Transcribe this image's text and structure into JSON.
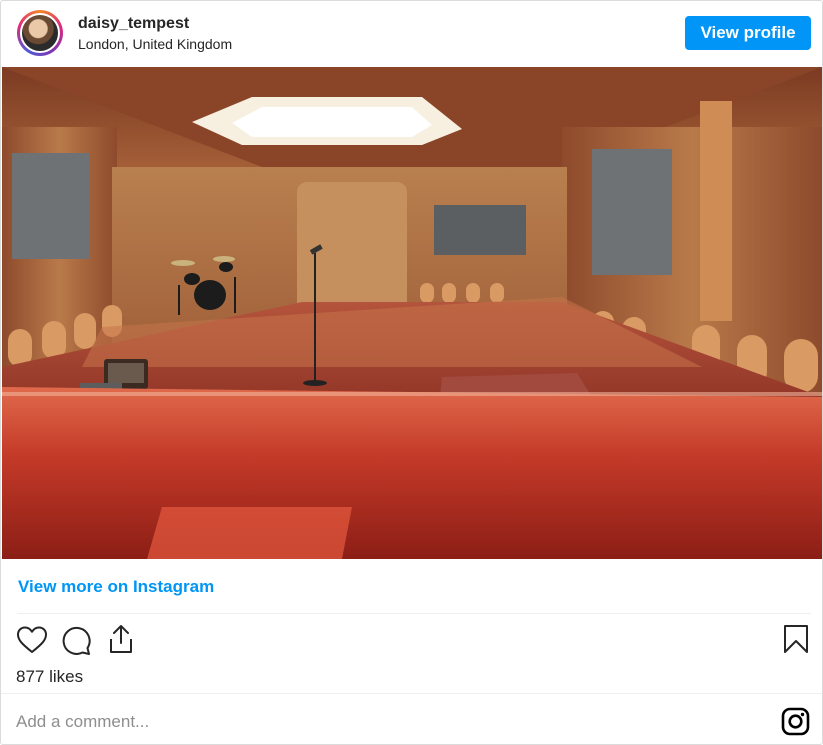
{
  "post": {
    "username": "daisy_tempest",
    "location": "London, United Kingdom",
    "view_profile_label": "View profile",
    "view_more_label": "View more on Instagram",
    "likes_text": "877 likes",
    "comment_placeholder": "Add a comment..."
  },
  "icons": {
    "like": "heart-icon",
    "comment": "comment-icon",
    "share": "share-icon",
    "save": "bookmark-icon",
    "brand": "instagram-icon"
  },
  "colors": {
    "accent": "#0095f6",
    "text": "#262626",
    "placeholder": "#8e8e8e",
    "divider": "#efefef"
  }
}
